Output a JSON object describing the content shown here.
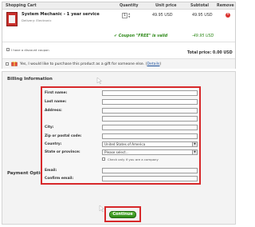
{
  "cart": {
    "headers": {
      "title": "Shopping Cart",
      "quantity": "Quantity",
      "unit_price": "Unit price",
      "subtotal": "Subtotal",
      "remove": "Remove"
    },
    "item": {
      "name": "System Mechanic - 1 year service",
      "delivery": "Delivery: Electronic",
      "quantity": "1",
      "unit_price": "49.95 USD",
      "subtotal": "49.95 USD"
    },
    "coupon": {
      "message": "Coupon \"FREE\" is valid",
      "price": "-49.95 USD"
    },
    "discount_label": "I have a discount coupon",
    "total": "Total price: 0.00 USD",
    "gift": {
      "text": "Yes, I would like to purchase this product as a gift for someone else.",
      "open_paren": "(",
      "details_link": "Details",
      "close_paren": ")"
    }
  },
  "billing": {
    "title": "Billing Information",
    "labels": {
      "first_name": "First name:",
      "last_name": "Last name:",
      "address": "Address:",
      "city": "City:",
      "zip": "Zip or postal code:",
      "country": "Country:",
      "state": "State or province:",
      "email": "Email:",
      "confirm_email": "Confirm email:"
    },
    "country_value": "United States of America",
    "state_value": "Please select...",
    "company_label": "Check only if you are a company"
  },
  "payment": {
    "title": "Payment Options",
    "continue_label": "Continue"
  },
  "colors": {
    "highlight": "#d7282a",
    "button_green": "#2e8a18",
    "coupon_green": "#2f8a1a",
    "link_blue": "#1a4f9c"
  }
}
